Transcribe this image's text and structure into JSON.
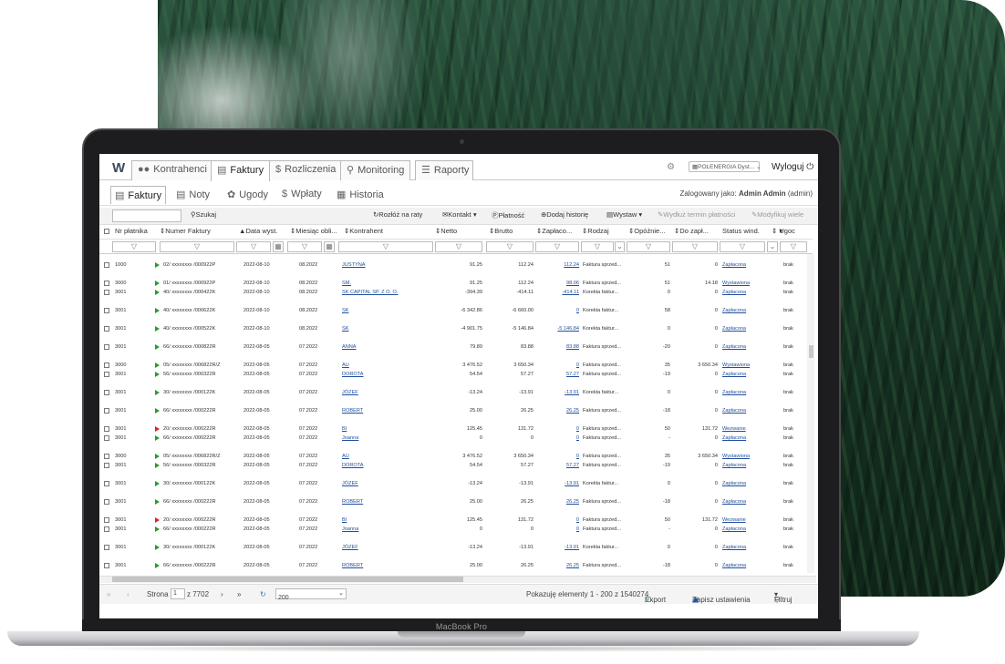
{
  "device": {
    "label": "MacBook Pro"
  },
  "topnav": {
    "logo": "W",
    "tabs": [
      {
        "label": "Kontrahenci",
        "icon": "users-icon"
      },
      {
        "label": "Faktury",
        "icon": "invoice-icon"
      },
      {
        "label": "Rozliczenia",
        "icon": "dollar-icon"
      },
      {
        "label": "Monitoring",
        "icon": "search-icon"
      },
      {
        "label": "Raporty",
        "icon": "list-icon"
      }
    ],
    "company_select": "POLENERGIA Dyst...",
    "logout_label": "Wyloguj"
  },
  "subnav": {
    "tabs": [
      {
        "label": "Faktury",
        "icon": "invoice-icon"
      },
      {
        "label": "Noty",
        "icon": "note-icon"
      },
      {
        "label": "Ugody",
        "icon": "handshake-icon"
      },
      {
        "label": "Wpłaty",
        "icon": "dollar-icon"
      },
      {
        "label": "Historia",
        "icon": "calendar-icon"
      }
    ],
    "logged_prefix": "Zalogowany jako:",
    "logged_user": "Admin Admin",
    "logged_login": "(admin)"
  },
  "toolbar": {
    "search_label": "Szukaj",
    "buttons": [
      "Rozłóż na raty",
      "Kontakt",
      "Płatność",
      "Dodaj historię",
      "Wystaw",
      "Wydłuż termin płatności",
      "Modyfikuj wiele"
    ]
  },
  "columns": [
    "Nr płatnika",
    "Numer Faktury",
    "Data wyst.",
    "Miesiąc obli...",
    "Kontrahent",
    "Netto",
    "Brutto",
    "Zapłaco...",
    "Rodzaj",
    "Opóźnie...",
    "Do zapł...",
    "Status wind.",
    "Ugoc"
  ],
  "rows": [
    {
      "payer": "1000",
      "flag": "green",
      "invoice": "02/ xxxxxxxx /000922P",
      "date": "2022-08-10",
      "month": "08.2022",
      "client": "JUSTYNA",
      "net": "91.25",
      "gross": "112.24",
      "paid": "112.24",
      "type": "Faktura sprzed...",
      "delay": "51",
      "due": "0",
      "status": "Zapłacona",
      "agreement": "brak",
      "gap": true
    },
    {
      "payer": "3000",
      "flag": "green",
      "invoice": "01/ xxxxxxxx /000922P",
      "date": "2022-08-10",
      "month": "08.2022",
      "client": "SM.",
      "net": "91.25",
      "gross": "112.24",
      "paid": "98.06",
      "type": "Faktura sprzed...",
      "delay": "51",
      "due": "14.18",
      "status": "Wystawiona",
      "agreement": "brak",
      "gap": false
    },
    {
      "payer": "3001",
      "flag": "green",
      "invoice": "40/ xxxxxxxx /000422K",
      "date": "2022-08-10",
      "month": "08.2022",
      "client": "SK CAPITAL SP. Z O. O.",
      "net": "-394.39",
      "gross": "-414.11",
      "paid": "-414.11",
      "type": "Korekta faktur...",
      "delay": "0",
      "due": "0",
      "status": "Zapłacona",
      "agreement": "brak",
      "gap": true
    },
    {
      "payer": "3001",
      "flag": "green",
      "invoice": "40/ xxxxxxxx /000622K",
      "date": "2022-08-10",
      "month": "08.2022",
      "client": "SK",
      "net": "-6 342.86",
      "gross": "-6 660.00",
      "paid": "0",
      "type": "Korekta faktur...",
      "delay": "58",
      "due": "0",
      "status": "Zapłacona",
      "agreement": "brak",
      "gap": true
    },
    {
      "payer": "3001",
      "flag": "green",
      "invoice": "40/ xxxxxxxx /000522K",
      "date": "2022-08-10",
      "month": "08.2022",
      "client": "SK",
      "net": "-4 901.75",
      "gross": "-5 146.84",
      "paid": "-5 146.84",
      "type": "Korekta faktur...",
      "delay": "0",
      "due": "0",
      "status": "Zapłacona",
      "agreement": "brak",
      "gap": true
    },
    {
      "payer": "3001",
      "flag": "green",
      "invoice": "66/ xxxxxxxx /000822R",
      "date": "2022-08-05",
      "month": "07.2022",
      "client": "ANNA",
      "net": "79.89",
      "gross": "83.88",
      "paid": "83.88",
      "type": "Faktura sprzed...",
      "delay": "-20",
      "due": "0",
      "status": "Zapłacona",
      "agreement": "brak",
      "gap": true
    },
    {
      "payer": "3000",
      "flag": "green",
      "invoice": "05/ xxxxxxxx /006822R/Z",
      "date": "2022-08-05",
      "month": "07.2022",
      "client": "AU",
      "net": "3 476.52",
      "gross": "3 650.34",
      "paid": "0",
      "type": "Faktura sprzed...",
      "delay": "35",
      "due": "3 650.34",
      "status": "Wystawiona",
      "agreement": "brak",
      "gap": false
    },
    {
      "payer": "3001",
      "flag": "green",
      "invoice": "56/ xxxxxxxx /000322R",
      "date": "2022-08-05",
      "month": "07.2022",
      "client": "DOROTA",
      "net": "54.54",
      "gross": "57.27",
      "paid": "57.27",
      "type": "Faktura sprzed...",
      "delay": "-19",
      "due": "0",
      "status": "Zapłacona",
      "agreement": "brak",
      "gap": true
    },
    {
      "payer": "3001",
      "flag": "green",
      "invoice": "30/ xxxxxxxx /000122K",
      "date": "2022-08-05",
      "month": "07.2022",
      "client": "JÓZEF",
      "net": "-13.24",
      "gross": "-13.91",
      "paid": "-13.91",
      "type": "Korekta faktur...",
      "delay": "0",
      "due": "0",
      "status": "Zapłacona",
      "agreement": "brak",
      "gap": true
    },
    {
      "payer": "3001",
      "flag": "green",
      "invoice": "66/ xxxxxxxx /000222R",
      "date": "2022-08-05",
      "month": "07.2022",
      "client": "ROBERT",
      "net": "25.00",
      "gross": "26.25",
      "paid": "26.25",
      "type": "Faktura sprzed...",
      "delay": "-18",
      "due": "0",
      "status": "Zapłacona",
      "agreement": "brak",
      "gap": true
    },
    {
      "payer": "3001",
      "flag": "red",
      "invoice": "20/ xxxxxxxx /000222R",
      "date": "2022-08-05",
      "month": "07.2022",
      "client": "BI",
      "net": "125.45",
      "gross": "131.72",
      "paid": "0",
      "type": "Faktura sprzed...",
      "delay": "50",
      "due": "131.72",
      "status": "Wezwanie",
      "agreement": "brak",
      "gap": false
    },
    {
      "payer": "3001",
      "flag": "green",
      "invoice": "66/ xxxxxxxx /000222R",
      "date": "2022-08-05",
      "month": "07.2022",
      "client": "Joanna",
      "net": "0",
      "gross": "0",
      "paid": "0",
      "type": "Faktura sprzed...",
      "delay": "-",
      "due": "0",
      "status": "Zapłacona",
      "agreement": "brak",
      "gap": true
    },
    {
      "payer": "3000",
      "flag": "green",
      "invoice": "05/ xxxxxxxx /006822R/Z",
      "date": "2022-08-05",
      "month": "07.2022",
      "client": "AU",
      "net": "3 476.52",
      "gross": "3 650.34",
      "paid": "0",
      "type": "Faktura sprzed...",
      "delay": "35",
      "due": "3 650.34",
      "status": "Wystawiona",
      "agreement": "brak",
      "gap": false
    },
    {
      "payer": "3001",
      "flag": "green",
      "invoice": "56/ xxxxxxxx /000322R",
      "date": "2022-08-05",
      "month": "07.2022",
      "client": "DOROTA",
      "net": "54.54",
      "gross": "57.27",
      "paid": "57.27",
      "type": "Faktura sprzed...",
      "delay": "-19",
      "due": "0",
      "status": "Zapłacona",
      "agreement": "brak",
      "gap": true
    },
    {
      "payer": "3001",
      "flag": "green",
      "invoice": "30/ xxxxxxxx /000122K",
      "date": "2022-08-05",
      "month": "07.2022",
      "client": "JÓZEF",
      "net": "-13.24",
      "gross": "-13.91",
      "paid": "-13.91",
      "type": "Korekta faktur...",
      "delay": "0",
      "due": "0",
      "status": "Zapłacona",
      "agreement": "brak",
      "gap": true
    },
    {
      "payer": "3001",
      "flag": "green",
      "invoice": "66/ xxxxxxxx /000222R",
      "date": "2022-08-05",
      "month": "07.2022",
      "client": "ROBERT",
      "net": "25.00",
      "gross": "26.25",
      "paid": "26.25",
      "type": "Faktura sprzed...",
      "delay": "-18",
      "due": "0",
      "status": "Zapłacona",
      "agreement": "brak",
      "gap": true
    },
    {
      "payer": "3001",
      "flag": "red",
      "invoice": "20/ xxxxxxxx /000222R",
      "date": "2022-08-05",
      "month": "07.2022",
      "client": "BI",
      "net": "125.45",
      "gross": "131.72",
      "paid": "0",
      "type": "Faktura sprzed...",
      "delay": "50",
      "due": "131.72",
      "status": "Wezwanie",
      "agreement": "brak",
      "gap": false
    },
    {
      "payer": "3001",
      "flag": "green",
      "invoice": "66/ xxxxxxxx /000222R",
      "date": "2022-08-05",
      "month": "07.2022",
      "client": "Joanna",
      "net": "0",
      "gross": "0",
      "paid": "0",
      "type": "Faktura sprzed...",
      "delay": "-",
      "due": "0",
      "status": "Zapłacona",
      "agreement": "brak",
      "gap": true
    },
    {
      "payer": "3001",
      "flag": "green",
      "invoice": "30/ xxxxxxxx /000122K",
      "date": "2022-08-05",
      "month": "07.2022",
      "client": "JÓZEF",
      "net": "-13.24",
      "gross": "-13.91",
      "paid": "-13.91",
      "type": "Korekta faktur...",
      "delay": "0",
      "due": "0",
      "status": "Zapłacona",
      "agreement": "brak",
      "gap": true
    },
    {
      "payer": "3001",
      "flag": "green",
      "invoice": "66/ xxxxxxxx /000222R",
      "date": "2022-08-05",
      "month": "07.2022",
      "client": "ROBERT",
      "net": "25.00",
      "gross": "26.25",
      "paid": "26.25",
      "type": "Faktura sprzed...",
      "delay": "-18",
      "due": "0",
      "status": "Zapłacona",
      "agreement": "brak",
      "gap": false
    }
  ],
  "pagination": {
    "page_label": "Strona",
    "page_value": "1",
    "of_label": "z 7702",
    "page_size": "200",
    "summary": "Pokazuję elementy 1 - 200 z 1540274",
    "export_label": "Export",
    "save_label": "Zapisz ustawienia",
    "filter_label": "Filtruj"
  },
  "colors": {
    "link": "#1f4e9c",
    "flag_green": "#2b9a2b",
    "flag_red": "#dd2222",
    "forest": "#1b3d2a"
  }
}
